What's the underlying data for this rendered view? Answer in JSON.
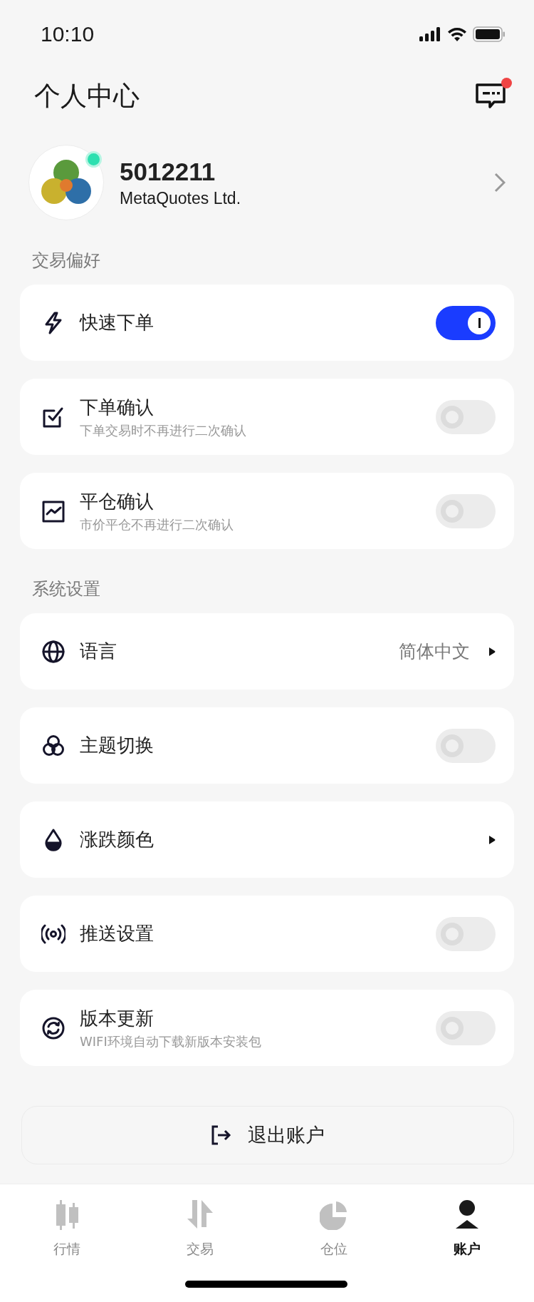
{
  "status_bar": {
    "time": "10:10"
  },
  "header": {
    "title": "个人中心",
    "unread": true
  },
  "profile": {
    "account": "5012211",
    "company": "MetaQuotes Ltd.",
    "online": true
  },
  "sections": [
    {
      "title": "交易偏好",
      "items": [
        {
          "kind": "toggle",
          "label": "快速下单",
          "on": true
        },
        {
          "kind": "toggle",
          "label": "下单确认",
          "subtitle": "下单交易时不再进行二次确认",
          "on": false
        },
        {
          "kind": "toggle",
          "label": "平仓确认",
          "subtitle": "市价平仓不再进行二次确认",
          "on": false
        }
      ]
    },
    {
      "title": "系统设置",
      "items": [
        {
          "kind": "link",
          "label": "语言",
          "value": "简体中文"
        },
        {
          "kind": "toggle",
          "label": "主题切换",
          "on": false
        },
        {
          "kind": "link",
          "label": "涨跌颜色"
        },
        {
          "kind": "toggle",
          "label": "推送设置",
          "on": false
        },
        {
          "kind": "toggle",
          "label": "版本更新",
          "subtitle": "WIFI环境自动下载新版本安装包",
          "on": false
        }
      ]
    }
  ],
  "logout": {
    "label": "退出账户"
  },
  "tabs": [
    {
      "label": "行情",
      "selected": false
    },
    {
      "label": "交易",
      "selected": false
    },
    {
      "label": "仓位",
      "selected": false
    },
    {
      "label": "账户",
      "selected": true
    }
  ]
}
